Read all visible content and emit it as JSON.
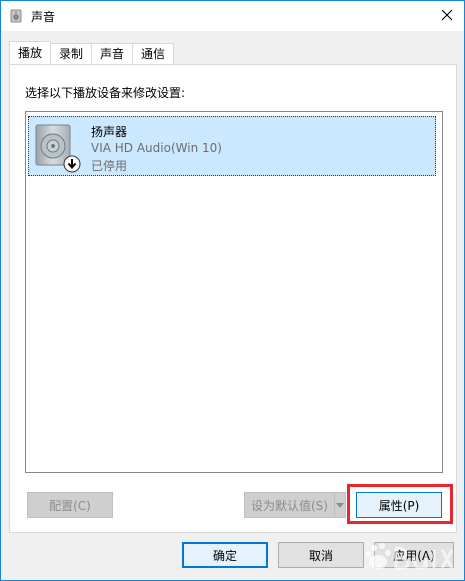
{
  "window": {
    "title": "声音",
    "icons": {
      "title": "speaker-icon",
      "close": "close-icon"
    }
  },
  "tabs": [
    {
      "label": "播放",
      "active": true
    },
    {
      "label": "录制",
      "active": false
    },
    {
      "label": "声音",
      "active": false
    },
    {
      "label": "通信",
      "active": false
    }
  ],
  "playback": {
    "instruction": "选择以下播放设备来修改设置:",
    "devices": [
      {
        "name": "扬声器",
        "driver": "VIA HD Audio(Win 10)",
        "status": "已停用",
        "icon": "speaker-icon",
        "badge": "down-arrow-icon"
      }
    ],
    "buttons": {
      "configure": "配置(C)",
      "set_default": "设为默认值(S)",
      "properties": "属性(P)"
    }
  },
  "dialog_buttons": {
    "ok": "确定",
    "cancel": "取消",
    "apply": "应用(A)"
  },
  "colors": {
    "selection": "#cce8ff",
    "highlight_box": "#e8262e",
    "window_border": "#1883d7"
  }
}
